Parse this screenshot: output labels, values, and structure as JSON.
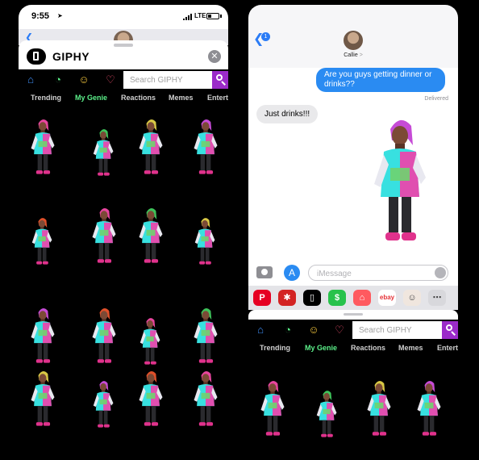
{
  "status_bar": {
    "time": "9:55",
    "network": "LTE"
  },
  "giphy": {
    "app_title": "GIPHY",
    "search_placeholder": "Search GIPHY",
    "tabs": [
      "Trending",
      "My Genie",
      "Reactions",
      "Memes",
      "Entert"
    ],
    "active_tab": "My Genie"
  },
  "messages": {
    "contact_name": "Callie",
    "contact_chevron": ">",
    "unread_count": "1",
    "outgoing": "Are you guys getting dinner or drinks??",
    "delivered_label": "Delivered",
    "incoming": "Just drinks!!!",
    "input_placeholder": "iMessage"
  },
  "app_strip": [
    {
      "name": "pinterest",
      "color": "#e60023",
      "glyph": "P"
    },
    {
      "name": "yelp",
      "color": "#d32323",
      "glyph": "✱"
    },
    {
      "name": "giphy",
      "color": "#000000",
      "glyph": "▯"
    },
    {
      "name": "cash",
      "color": "#28c24b",
      "glyph": "$"
    },
    {
      "name": "airbnb-like",
      "color": "#ff5a5f",
      "glyph": "⌂"
    },
    {
      "name": "ebay",
      "color": "#ffffff",
      "glyph": "ebay"
    },
    {
      "name": "memoji",
      "color": "#f0e6de",
      "glyph": "☺"
    },
    {
      "name": "more",
      "color": "#d8d8dc",
      "glyph": "⋯"
    }
  ],
  "colors": {
    "accent_green": "#5cf08a",
    "imessage_blue": "#2a8bf2",
    "giphy_purple": "#9b2bc9",
    "hair_colors": [
      "#e8459e",
      "#3ec35a",
      "#d8c845",
      "#c64bd6",
      "#e0502a"
    ]
  },
  "sticker_description_icon": "genie-avatar-sticker"
}
